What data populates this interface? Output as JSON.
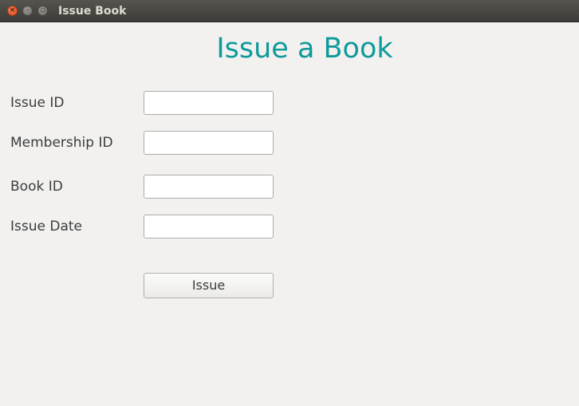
{
  "window": {
    "title": "Issue Book",
    "close_glyph": "×",
    "minimize_glyph": "–",
    "maximize_glyph": "▫"
  },
  "form": {
    "heading": "Issue a Book",
    "fields": [
      {
        "label": "Issue ID",
        "value": "",
        "placeholder": ""
      },
      {
        "label": "Membership ID",
        "value": "",
        "placeholder": ""
      },
      {
        "label": "Book ID",
        "value": "",
        "placeholder": ""
      },
      {
        "label": "Issue Date",
        "value": "",
        "placeholder": ""
      }
    ],
    "submit_label": "Issue"
  },
  "colors": {
    "heading": "#0f9a9a",
    "background": "#f2f1f0",
    "titlebar": "#3c3b37"
  }
}
